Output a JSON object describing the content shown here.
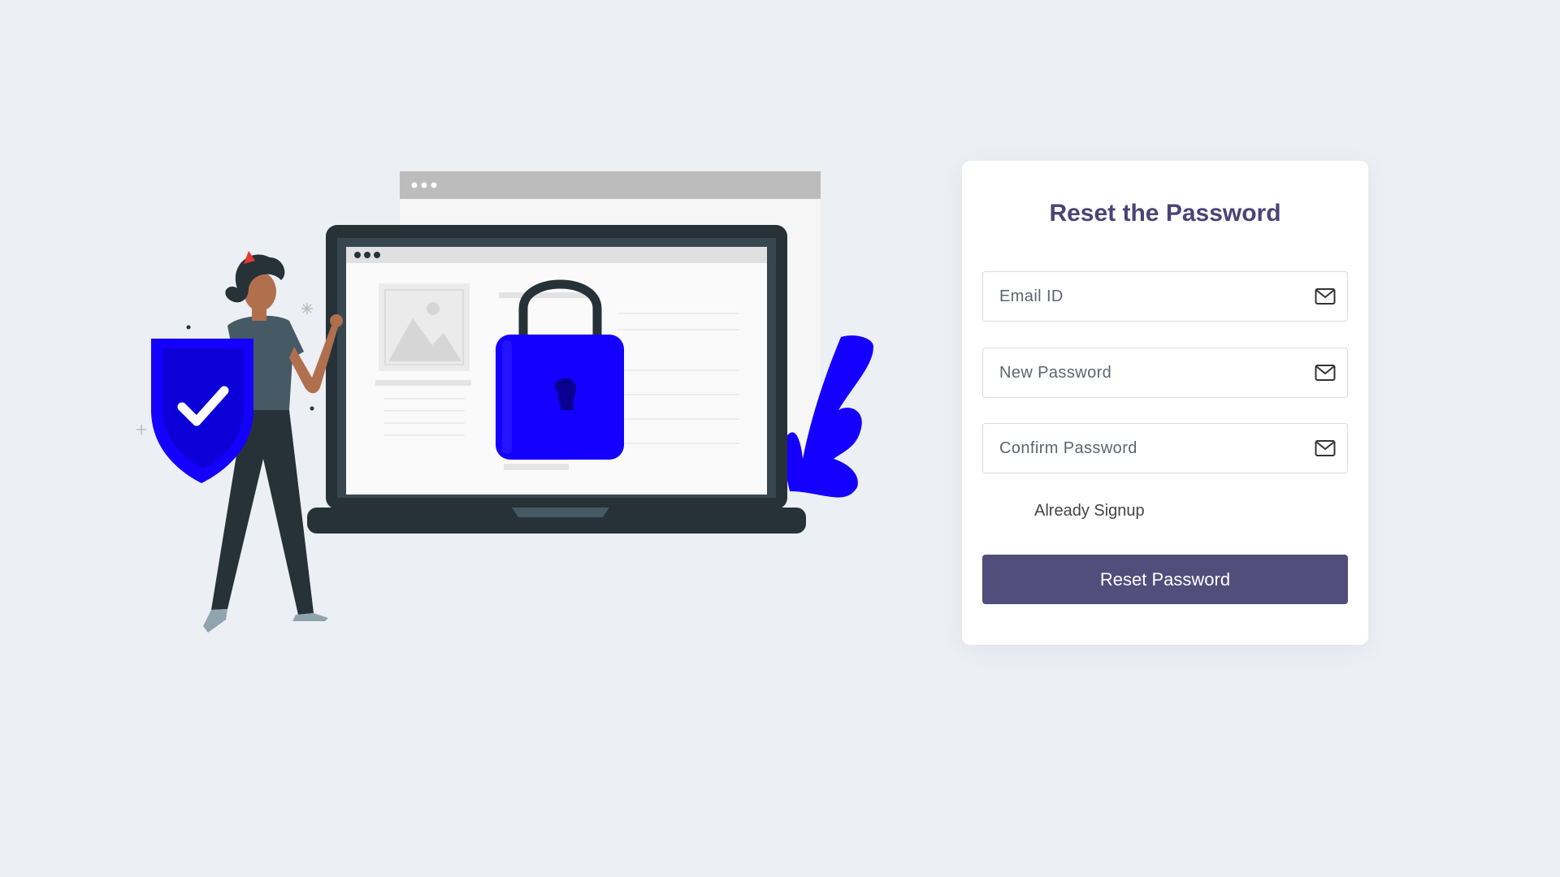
{
  "form": {
    "title": "Reset the Password",
    "email_placeholder": "Email ID",
    "new_password_placeholder": "New Password",
    "confirm_password_placeholder": "Confirm Password",
    "field_icon": "envelope-icon",
    "already_signup_label": "Already Signup",
    "submit_label": "Reset Password"
  },
  "colors": {
    "background": "#eceff4",
    "title": "#4a4476",
    "button": "#534d7c",
    "accent_illustration": "#1400ff"
  }
}
